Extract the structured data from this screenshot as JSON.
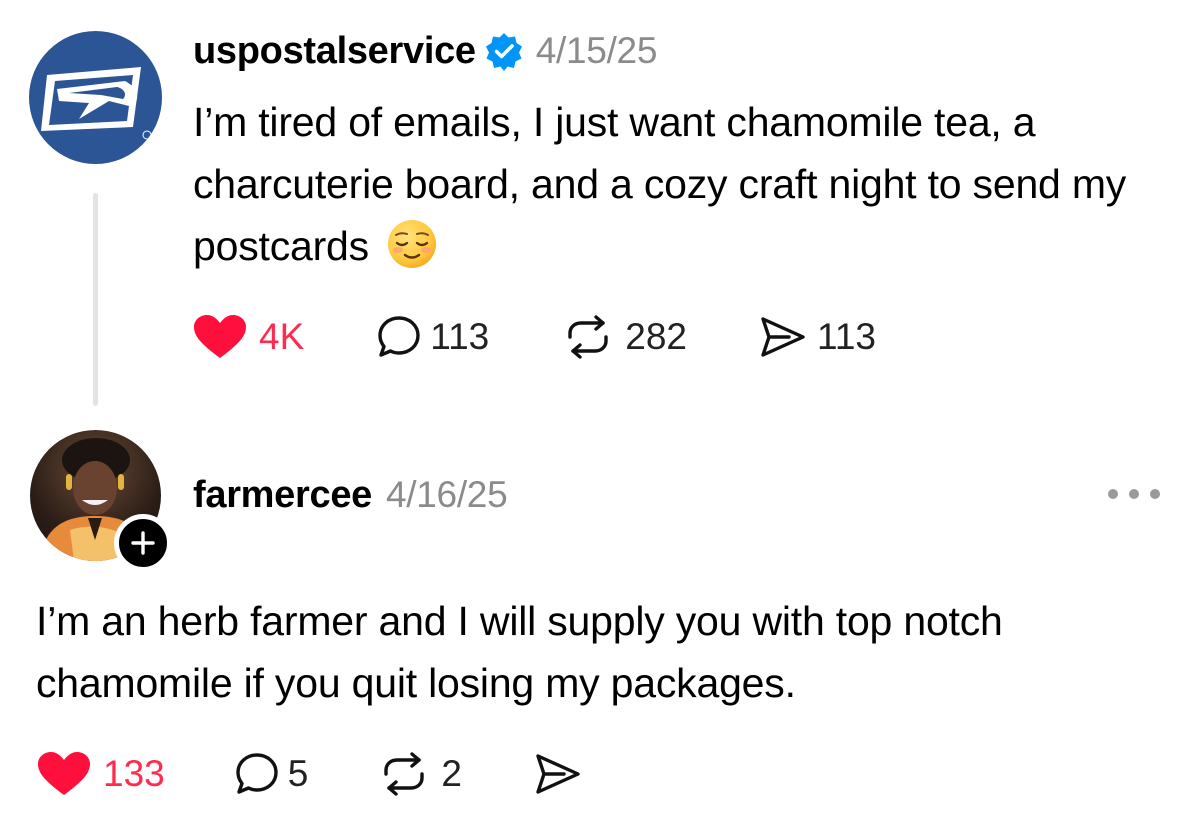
{
  "post": {
    "username": "uspostalservice",
    "verified_icon": "verified-badge-icon",
    "date": "4/15/25",
    "text": "I’m tired of emails, I just want chamomile tea, a charcuterie board, and a cozy craft night to send my postcards",
    "emoji": "relieved-face-emoji",
    "likes": "4K",
    "comments": "113",
    "reposts": "282",
    "shares": "113"
  },
  "reply": {
    "username": "farmercee",
    "date": "4/16/25",
    "text": "I’m an herb farmer and I will supply you with top notch chamomile if you quit losing my packages.",
    "likes": "133",
    "comments": "5",
    "reposts": "2"
  },
  "colors": {
    "like_red": "#ff2b4f",
    "verified_blue": "#0095f6",
    "usps_blue": "#2b5595",
    "muted_gray": "#8b8b8b"
  }
}
